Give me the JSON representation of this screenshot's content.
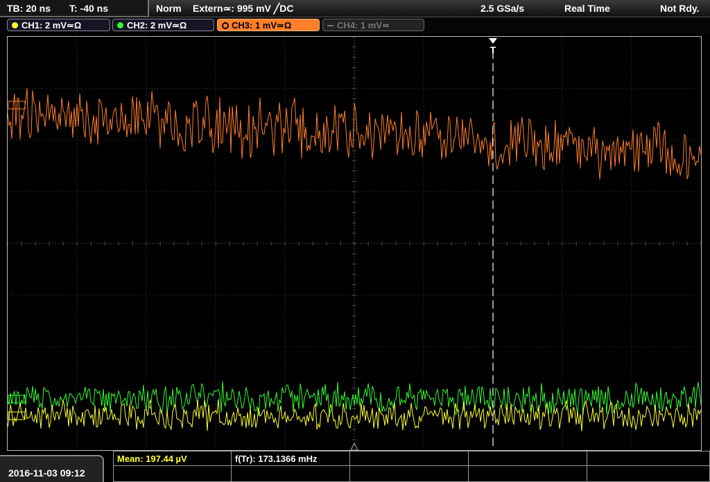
{
  "status_bar": {
    "timebase": "TB: 20 ns",
    "trigger_time": "T: -40 ns",
    "trigger_mode": "Norm",
    "trigger_source": "Extern≃: 995 mV ╱DC",
    "sample_rate": "2.5 GSa/s",
    "acquisition": "Real Time",
    "run_state": "Not Rdy."
  },
  "channels": [
    {
      "id": "CH1",
      "label": "CH1: 2 mV≃Ω",
      "color": "#ffff33",
      "active": true,
      "selected": false
    },
    {
      "id": "CH2",
      "label": "CH2: 2 mV≃Ω",
      "color": "#33ff33",
      "active": true,
      "selected": false
    },
    {
      "id": "CH3",
      "label": "CH3: 1 mV≃Ω",
      "color": "#ff7f2a",
      "active": true,
      "selected": true
    },
    {
      "id": "CH4",
      "label": "CH4: 1 mV≃",
      "color": "#777777",
      "active": false,
      "selected": false
    }
  ],
  "screen": {
    "background": "#000000",
    "grid_color": "#7a7a7a",
    "trigger_marker_icon": "T"
  },
  "measurements": {
    "mean_label": "Mean: 197.44 µV",
    "mean_color": "#ffff33",
    "freq_label": "f(Tr): 173.1366 mHz"
  },
  "datetime": "2016-11-03 09:12"
}
